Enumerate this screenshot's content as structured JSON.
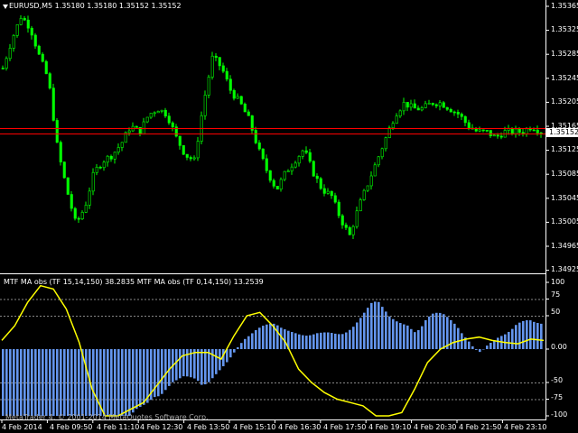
{
  "header": {
    "symbol_info": "EURUSD,M5  1.35180 1.35180 1.35152 1.35152"
  },
  "indicator": {
    "info": "MTF MA obs (TF 15,14,150) 38.2835  MTF MA obs (TF 0,14,150) 13.2539"
  },
  "copyright": "MetaTrader 4, © 2001-2014 MetaQuotes Software Corp.",
  "price_axis": [
    "1.35365",
    "1.35325",
    "1.35285",
    "1.35245",
    "1.35205",
    "1.35165",
    "1.35125",
    "1.35085",
    "1.35045",
    "1.35005",
    "1.34965",
    "1.34925"
  ],
  "current_price": "1.35152",
  "indicator_axis": [
    "100",
    "75",
    "50",
    "0.00",
    "-50",
    "-75",
    "-100"
  ],
  "time_axis": [
    "4 Feb 2014",
    "4 Feb 09:50",
    "4 Feb 11:10",
    "4 Feb 12:30",
    "4 Feb 13:50",
    "4 Feb 15:10",
    "4 Feb 16:30",
    "4 Feb 17:50",
    "4 Feb 19:10",
    "4 Feb 20:30",
    "4 Feb 21:50",
    "4 Feb 23:10"
  ],
  "colors": {
    "background": "#000000",
    "candles": "#00ff00",
    "histogram": "#6495ed",
    "ma_line": "#ffff00",
    "price_line": "#ff0000",
    "grid": "#ffffff"
  },
  "chart_data": [
    {
      "type": "candlestick",
      "title": "EURUSD,M5",
      "ylim": [
        1.3491,
        1.3537
      ],
      "close_path": [
        1.3526,
        1.3531,
        1.3535,
        1.3533,
        1.3528,
        1.3524,
        1.3512,
        1.3505,
        1.3499,
        1.3502,
        1.3508,
        1.351,
        1.3511,
        1.3513,
        1.3516,
        1.3515,
        1.3518,
        1.3519,
        1.3518,
        1.3514,
        1.3511,
        1.351,
        1.352,
        1.3528,
        1.3526,
        1.3522,
        1.352,
        1.3517,
        1.3512,
        1.3508,
        1.3505,
        1.3508,
        1.351,
        1.3512,
        1.3508,
        1.3505,
        1.3504,
        1.35,
        1.3497,
        1.3502,
        1.3506,
        1.351,
        1.3514,
        1.3518,
        1.352,
        1.3519,
        1.3519,
        1.352,
        1.352,
        1.3519,
        1.3518,
        1.3516,
        1.3515,
        1.3515,
        1.3514,
        1.3515,
        1.3515,
        1.3515,
        1.3516,
        1.3515
      ]
    },
    {
      "type": "histogram",
      "title": "MTF MA obs (TF 15,14,150)",
      "ylim": [
        -100,
        100
      ],
      "values": [
        -100,
        -100,
        -100,
        -100,
        -100,
        -100,
        -100,
        -100,
        -100,
        -100,
        -100,
        -100,
        -100,
        -100,
        -100,
        -100,
        -100,
        -100,
        -100,
        -100,
        -100,
        -100,
        -90,
        -85,
        -80,
        -72,
        -70,
        -60,
        -50,
        -45,
        -40,
        -42,
        -45,
        -55,
        -50,
        -40,
        -30,
        -20,
        -8,
        5,
        15,
        22,
        30,
        35,
        38,
        38,
        32,
        28,
        25,
        22,
        20,
        21,
        24,
        25,
        25,
        23,
        22,
        26,
        34,
        45,
        58,
        70,
        72,
        60,
        48,
        42,
        38,
        35,
        25,
        30,
        45,
        53,
        55,
        52,
        44,
        35,
        22,
        12,
        0,
        -5,
        5,
        12,
        18,
        22,
        28,
        38,
        42,
        44,
        40,
        38
      ]
    },
    {
      "type": "line",
      "title": "MTF MA obs (TF 0,14,150)",
      "ylim": [
        -100,
        100
      ],
      "values": [
        13,
        35,
        70,
        95,
        90,
        60,
        10,
        -60,
        -100,
        -100,
        -90,
        -80,
        -55,
        -30,
        -10,
        -5,
        -5,
        -15,
        20,
        50,
        55,
        35,
        10,
        -30,
        -50,
        -65,
        -75,
        -80,
        -85,
        -100,
        -100,
        -95,
        -60,
        -20,
        0,
        10,
        15,
        18,
        13,
        10,
        8,
        15,
        13
      ]
    }
  ]
}
